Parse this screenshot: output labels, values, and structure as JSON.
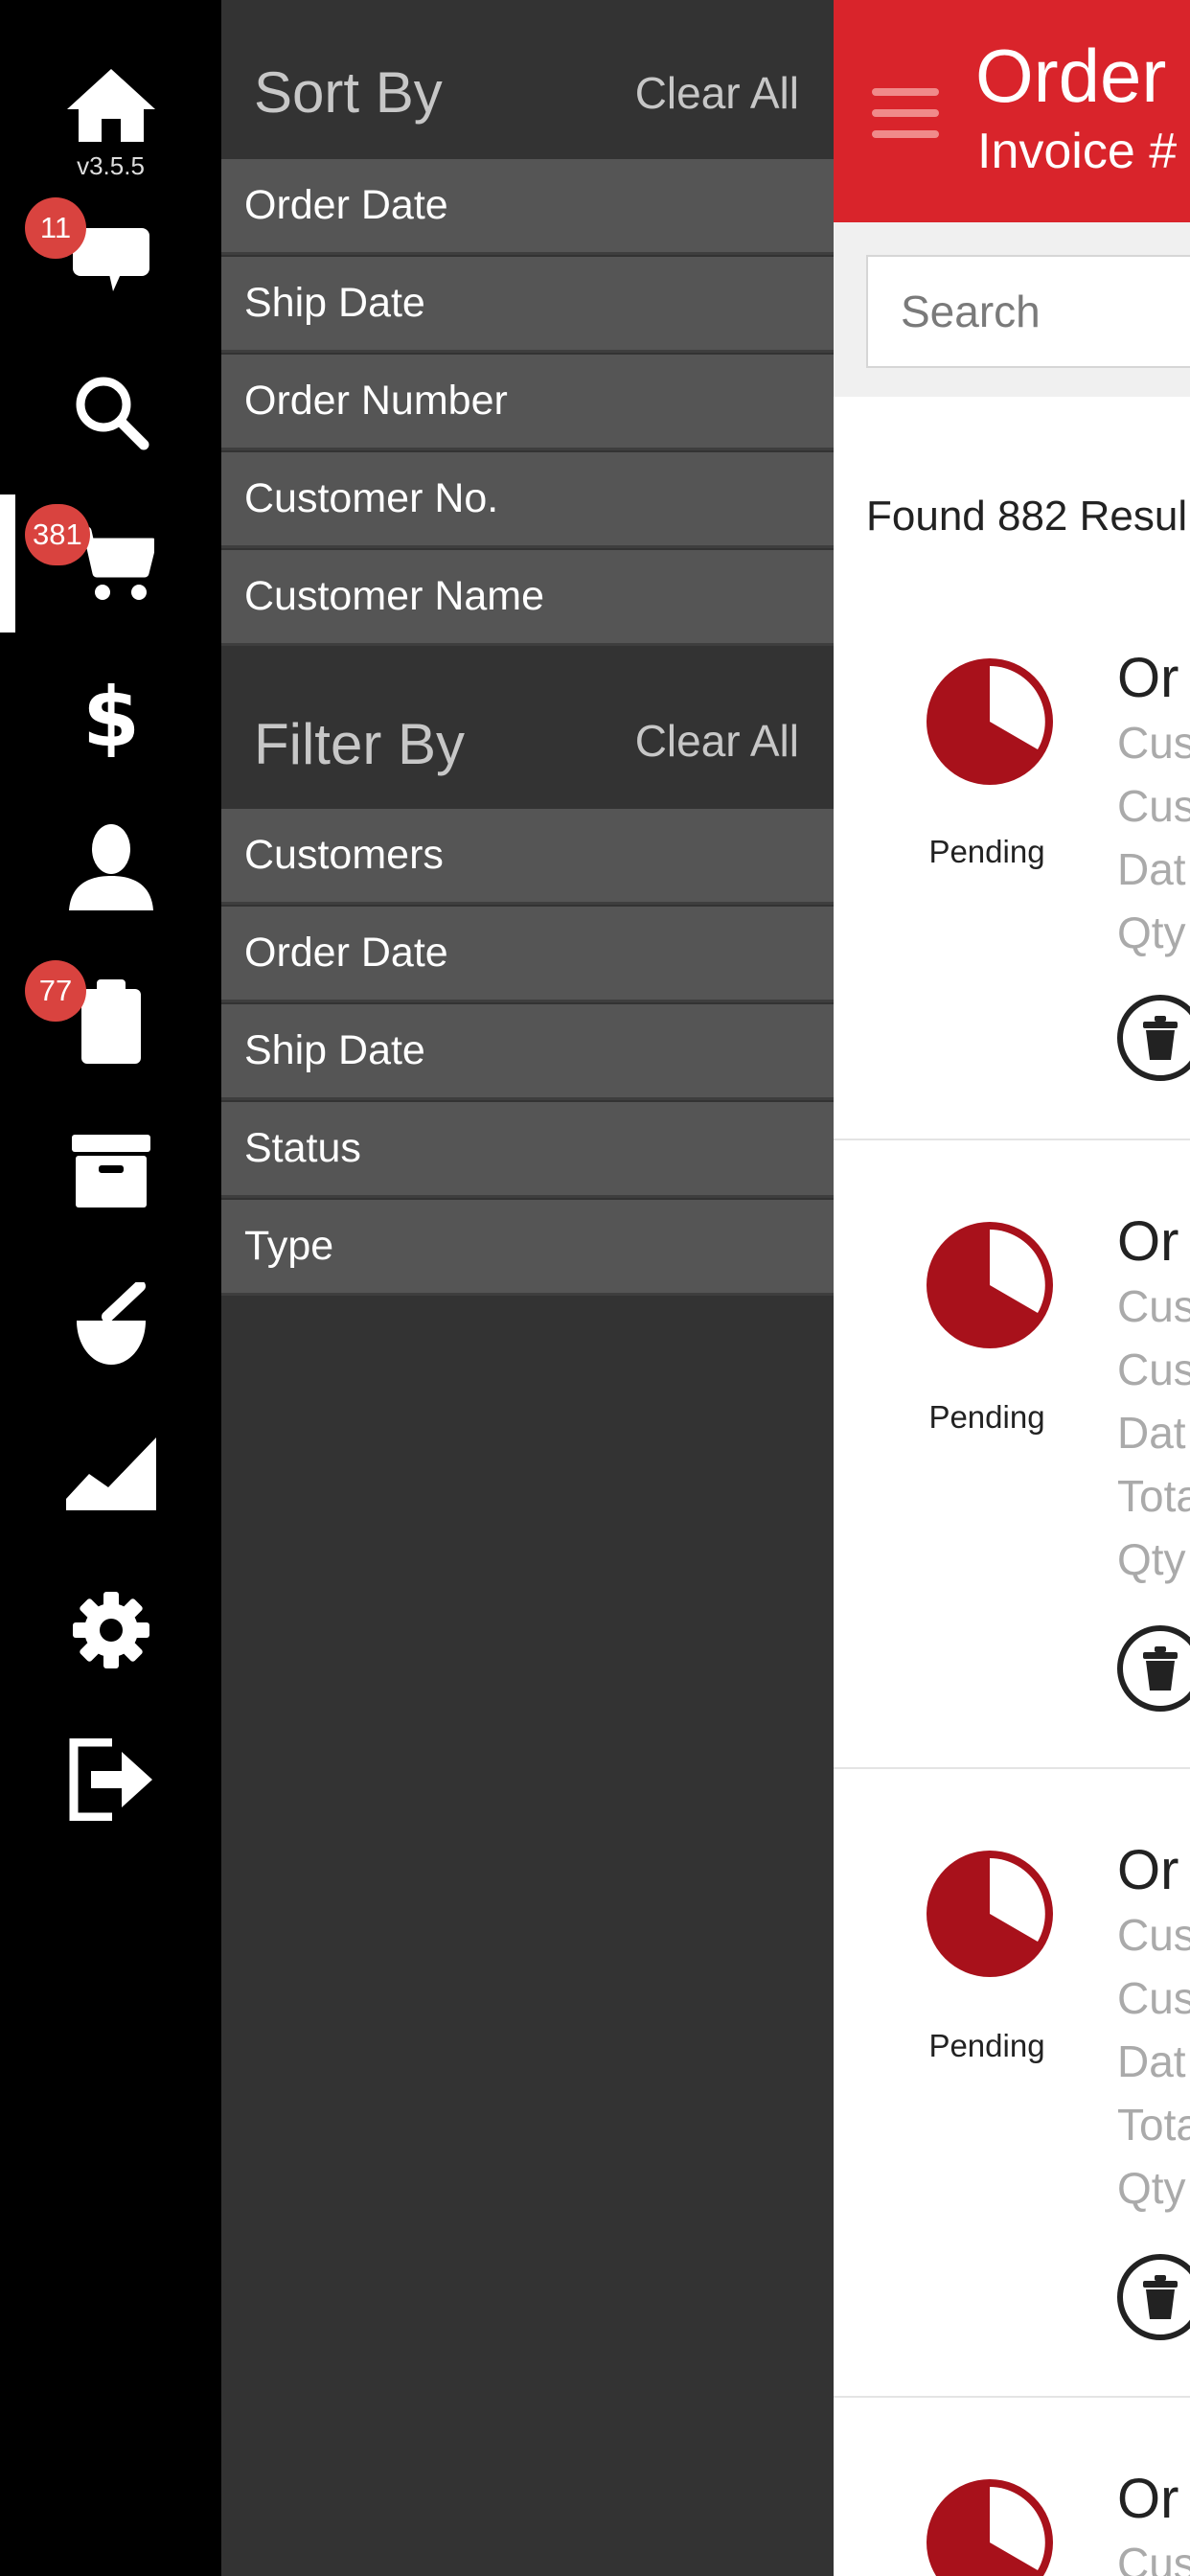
{
  "rail": {
    "version": "v3.5.5",
    "badges": {
      "messages": "11",
      "cart": "381",
      "clipboard": "77"
    },
    "icons": [
      "home-icon",
      "chat-icon",
      "search-icon",
      "cart-icon",
      "dollar-icon",
      "user-icon",
      "clipboard-icon",
      "archive-icon",
      "mortar-pestle-icon",
      "chart-icon",
      "gear-icon",
      "logout-icon"
    ]
  },
  "panel": {
    "sort_title": "Sort By",
    "sort_clear": "Clear All",
    "sort_options": [
      "Order Date",
      "Ship Date",
      "Order Number",
      "Customer No.",
      "Customer Name"
    ],
    "filter_title": "Filter By",
    "filter_clear": "Clear All",
    "filter_options": [
      "Customers",
      "Order Date",
      "Ship Date",
      "Status",
      "Type"
    ]
  },
  "header": {
    "title": "Order",
    "subtitle": "Invoice #"
  },
  "search": {
    "placeholder": "Search",
    "value": ""
  },
  "results_text": "Found 882 Resul",
  "orders": [
    {
      "status": "Pending",
      "title": "Or",
      "fields": [
        "Cus",
        "Cus",
        "Dat",
        "Qty"
      ]
    },
    {
      "status": "Pending",
      "title": "Or",
      "fields": [
        "Cus",
        "Cus",
        "Dat",
        "Tota",
        "Qty"
      ]
    },
    {
      "status": "Pending",
      "title": "Or",
      "fields": [
        "Cus",
        "Cus",
        "Dat",
        "Tota",
        "Qty"
      ]
    },
    {
      "status": "",
      "title": "Or",
      "fields": [
        "Cus"
      ]
    }
  ],
  "colors": {
    "accent": "#d9242b",
    "badge": "#d9433f",
    "pie": "#a8111b",
    "panel": "#333333",
    "option": "#555555"
  }
}
